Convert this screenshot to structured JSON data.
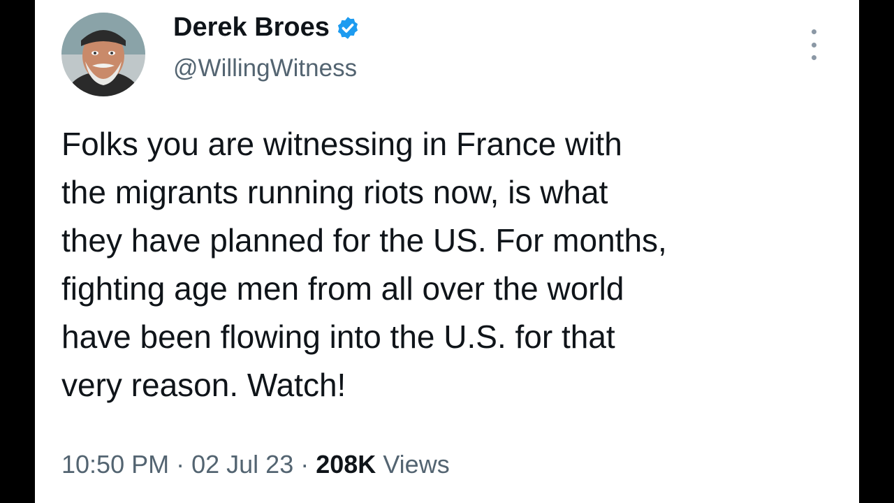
{
  "tweet": {
    "author": {
      "display_name": "Derek Broes",
      "handle": "@WillingWitness",
      "verified": true,
      "verified_icon": "verified-badge-icon",
      "avatar_icon": "avatar-portrait"
    },
    "text_lines": [
      "Folks you are witnessing in France with",
      "the migrants running riots now, is what",
      "they have planned for the US. For months,",
      "fighting age men from all over the world",
      "have been flowing into the U.S. for that",
      "very reason. Watch!"
    ],
    "meta": {
      "time": "10:50 PM",
      "separator": "·",
      "date": "02 Jul 23",
      "views_count": "208K",
      "views_label": "Views"
    },
    "more_icon": "more-vertical-icon"
  },
  "colors": {
    "text_primary": "#0f1419",
    "text_secondary": "#536471",
    "verified_blue": "#1d9bf0",
    "background": "#ffffff",
    "frame": "#000000"
  }
}
